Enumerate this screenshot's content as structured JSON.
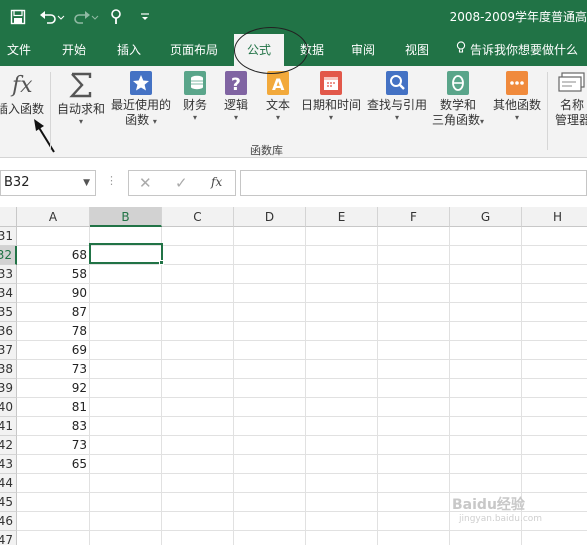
{
  "window": {
    "title": "2008-2009学年度普通高"
  },
  "qat": {
    "save_icon": "save-icon",
    "undo_icon": "undo-icon",
    "redo_icon": "redo-icon",
    "touch_icon": "touch-mode-icon",
    "customize_icon": "customize-qat-icon"
  },
  "tabs": [
    {
      "label": "文件"
    },
    {
      "label": "开始"
    },
    {
      "label": "插入"
    },
    {
      "label": "页面布局"
    },
    {
      "label": "公式",
      "active": true
    },
    {
      "label": "数据"
    },
    {
      "label": "审阅"
    },
    {
      "label": "视图"
    }
  ],
  "tell_me": {
    "label": "告诉我你想要做什么"
  },
  "ribbon": {
    "insert_function": {
      "label": "插入函数",
      "icon": "fx-icon"
    },
    "autosum": {
      "label": "自动求和",
      "icon": "sigma-icon"
    },
    "recent": {
      "label1": "最近使用的",
      "label2": "函数",
      "icon": "star-book-icon"
    },
    "financial": {
      "label": "财务",
      "icon": "coins-book-icon"
    },
    "logical": {
      "label": "逻辑",
      "icon": "question-book-icon"
    },
    "text": {
      "label": "文本",
      "icon": "text-book-icon"
    },
    "datetime": {
      "label": "日期和时间",
      "icon": "calendar-book-icon"
    },
    "lookup": {
      "label": "查找与引用",
      "icon": "magnifier-book-icon"
    },
    "math": {
      "label1": "数学和",
      "label2": "三角函数",
      "icon": "theta-book-icon"
    },
    "more": {
      "label": "其他函数",
      "icon": "more-book-icon"
    },
    "name_manager": {
      "label1": "名称",
      "label2": "管理器",
      "icon": "name-manager-icon"
    },
    "group_label": "函数库"
  },
  "formula_bar": {
    "name_box": "B32",
    "fx": "fx",
    "value": ""
  },
  "grid": {
    "columns": [
      "A",
      "B",
      "C",
      "D",
      "E",
      "F",
      "G",
      "H"
    ],
    "rows": [
      {
        "num": "31",
        "a": ""
      },
      {
        "num": "32",
        "a": "68"
      },
      {
        "num": "33",
        "a": "58"
      },
      {
        "num": "34",
        "a": "90"
      },
      {
        "num": "35",
        "a": "87"
      },
      {
        "num": "36",
        "a": "78"
      },
      {
        "num": "37",
        "a": "69"
      },
      {
        "num": "38",
        "a": "73"
      },
      {
        "num": "39",
        "a": "92"
      },
      {
        "num": "40",
        "a": "81"
      },
      {
        "num": "41",
        "a": "83"
      },
      {
        "num": "42",
        "a": "73"
      },
      {
        "num": "43",
        "a": "65"
      },
      {
        "num": "44",
        "a": ""
      },
      {
        "num": "45",
        "a": ""
      },
      {
        "num": "46",
        "a": ""
      },
      {
        "num": "47",
        "a": ""
      }
    ],
    "selected_column": "B",
    "selected_row": "32"
  },
  "colors": {
    "accent": "#217346",
    "ribbon_bg": "#f3f3f3"
  },
  "watermark": {
    "main": "Baidu经验",
    "sub": "jingyan.baidu.com"
  }
}
